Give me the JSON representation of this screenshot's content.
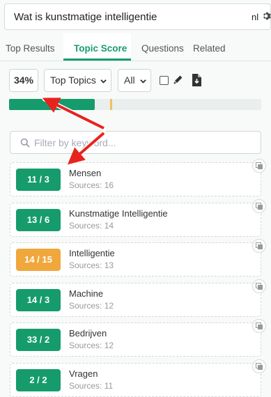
{
  "search": {
    "query": "Wat is kunstmatige intelligentie",
    "language": "nl"
  },
  "tabs": [
    {
      "label": "Top Results",
      "active": false
    },
    {
      "label": "Topic Score",
      "active": true
    },
    {
      "label": "Questions",
      "active": false
    },
    {
      "label": "Related",
      "active": false
    }
  ],
  "toolbar": {
    "score": "34%",
    "topic_filter": "Top Topics",
    "scope_filter": "All",
    "checkbox_checked": false
  },
  "progress": {
    "value": 0.34,
    "marker": 0.4,
    "color": "#169c6c",
    "marker_color": "#f0c060"
  },
  "filter": {
    "placeholder": "Filter by keyword..."
  },
  "colors": {
    "green": "#169c6c",
    "orange": "#f0a73c",
    "arrow": "#e8231e"
  },
  "topics": [
    {
      "score": "11 / 3",
      "name": "Mensen",
      "sources": "Sources: 16",
      "status": "green"
    },
    {
      "score": "13 / 6",
      "name": "Kunstmatige Intelligentie",
      "sources": "Sources: 14",
      "status": "green"
    },
    {
      "score": "14 / 15",
      "name": "Intelligentie",
      "sources": "Sources: 13",
      "status": "orange"
    },
    {
      "score": "14 / 3",
      "name": "Machine",
      "sources": "Sources: 12",
      "status": "green"
    },
    {
      "score": "33 / 2",
      "name": "Bedrijven",
      "sources": "Sources: 12",
      "status": "green"
    },
    {
      "score": "2 / 2",
      "name": "Vragen",
      "sources": "Sources: 11",
      "status": "green"
    }
  ]
}
